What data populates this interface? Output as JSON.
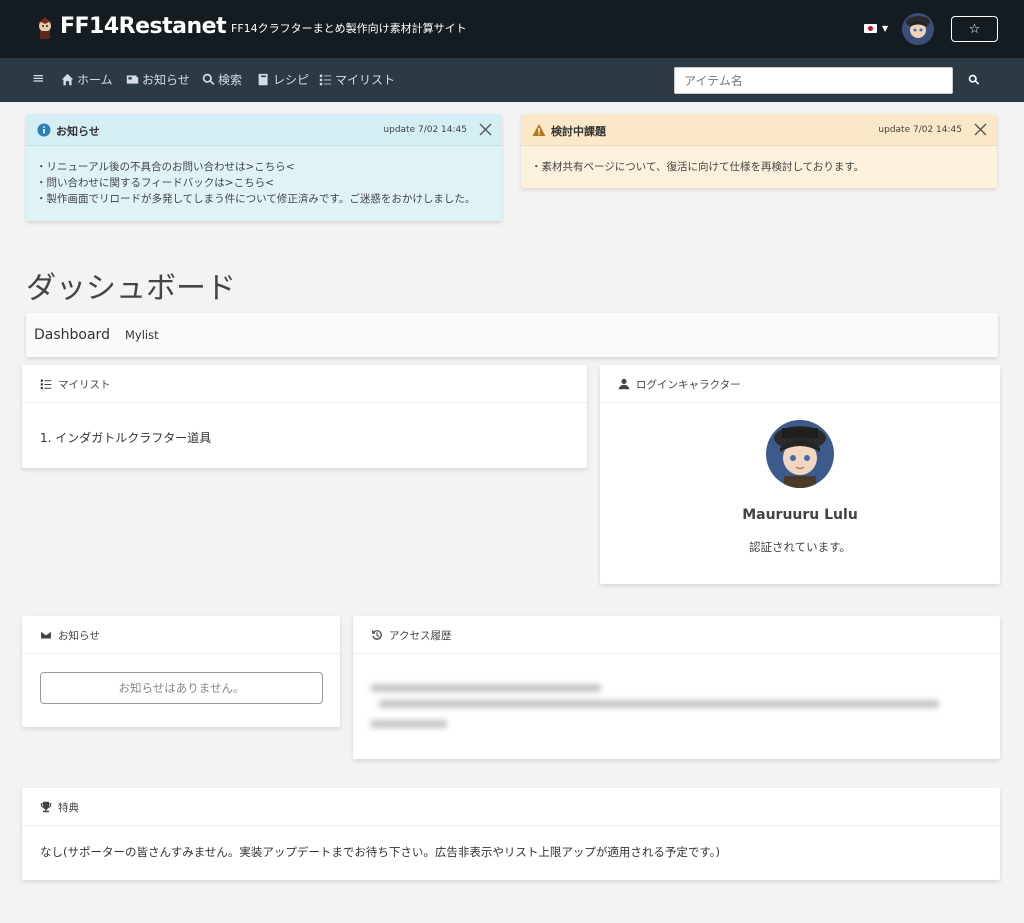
{
  "header": {
    "brand": "FF14Restanet",
    "tagline": "FF14クラフターまとめ製作向け素材計算サイト",
    "star_label": "☆"
  },
  "nav": {
    "menu_label": "≡",
    "items": [
      {
        "label": "ホーム",
        "icon": "home-icon"
      },
      {
        "label": "お知らせ",
        "icon": "newspaper-icon"
      },
      {
        "label": "検索",
        "icon": "search-icon"
      },
      {
        "label": "レシピ",
        "icon": "book-icon"
      },
      {
        "label": "マイリスト",
        "icon": "list-icon"
      }
    ],
    "search_placeholder": "アイテム名"
  },
  "alerts": {
    "info": {
      "title": "お知らせ",
      "update": "update 7/02 14:45",
      "lines": [
        "・リニューアル後の不具合のお問い合わせは>こちら<",
        "・問い合わせに関するフィードバックは>こちら<",
        "・製作画面でリロードが多発してしまう件について修正済みです。ご迷惑をおかけしました。"
      ]
    },
    "warning": {
      "title": "検討中課題",
      "update": "update 7/02 14:45",
      "lines": [
        "・素材共有ページについて、復活に向けて仕様を再検討しております。"
      ]
    }
  },
  "page_title": "ダッシュボード",
  "tabs": {
    "active": "Dashboard",
    "other": "Mylist"
  },
  "mylist_card": {
    "title": "マイリスト",
    "items": [
      "1. インダガトルクラフター道具"
    ]
  },
  "login_card": {
    "title": "ログインキャラクター",
    "character_name": "Mauruuru Lulu",
    "status": "認証されています。"
  },
  "news_card": {
    "title": "お知らせ",
    "empty": "お知らせはありません。"
  },
  "history_card": {
    "title": "アクセス履歴"
  },
  "perks_card": {
    "title": "特典",
    "text": "なし(サポーターの皆さんすみません。実装アップデートまでお待ち下さい。広告非表示やリスト上限アップが適用される予定です。)"
  },
  "colors": {
    "topbar": "#141c22",
    "navbar": "#2c3a46",
    "info_bg": "#dff3f7",
    "warning_bg": "#fdf1dd",
    "info_icon": "#2d7fb8",
    "warning_icon": "#b07b1d"
  }
}
